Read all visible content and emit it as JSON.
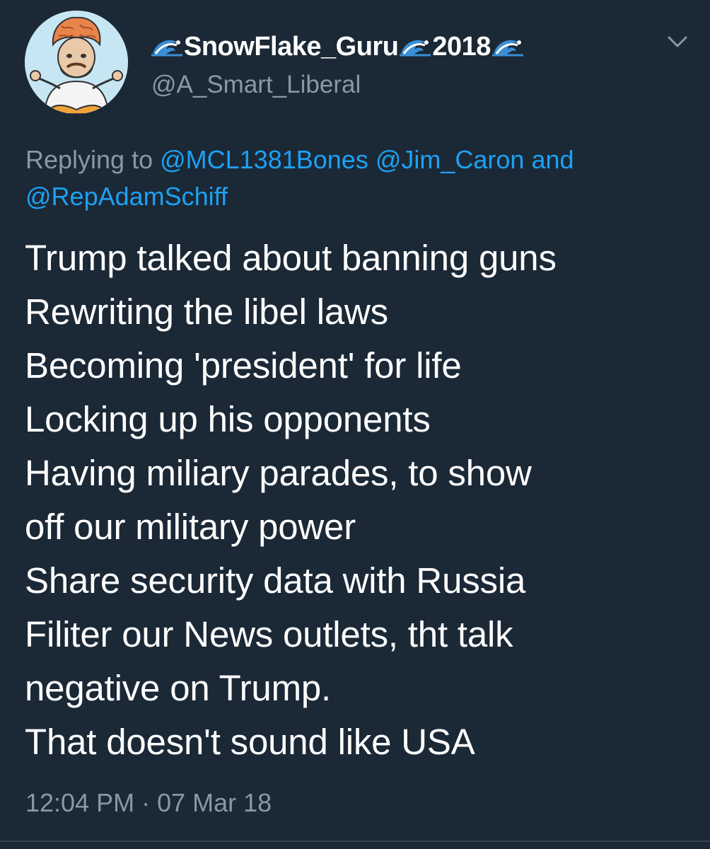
{
  "author": {
    "display_name_part1": "SnowFlake_Guru",
    "display_name_part2": "2018",
    "handle": "@A_Smart_Liberal",
    "avatar_icon": "cartoon-meditating-figure-avatar",
    "name_icon": "water-wave-icon"
  },
  "reply": {
    "prefix": "Replying to ",
    "mention1": "@MCL1381Bones",
    "mention2": "@Jim_Caron",
    "conjunction": " and",
    "mention3": "@RepAdamSchiff"
  },
  "tweet": {
    "lines": [
      "Trump talked about banning guns",
      "Rewriting the libel laws",
      "Becoming 'president' for life",
      "Locking up his opponents",
      "Having miliary parades, to show",
      "off our military power",
      "Share security data with Russia",
      "Filiter our News outlets, tht talk",
      "negative on Trump.",
      "That doesn't sound like USA"
    ],
    "time": "12:04 PM",
    "separator": " · ",
    "date": "07 Mar 18"
  },
  "colors": {
    "background": "#1b2836",
    "text": "#ffffff",
    "secondary": "#8899a6",
    "link": "#1da1f2"
  }
}
